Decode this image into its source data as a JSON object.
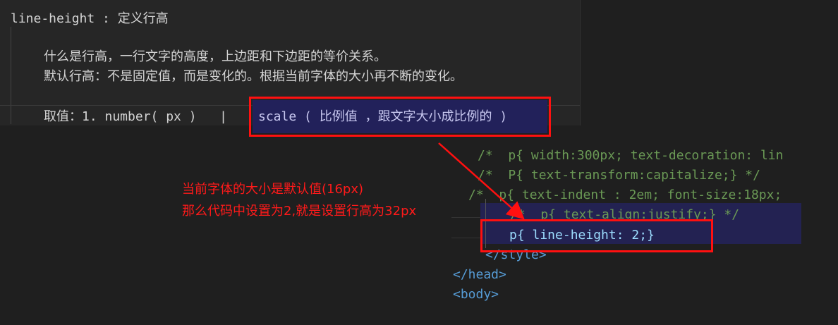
{
  "notes": {
    "title": "line-height : 定义行高",
    "line1": "什么是行高，一行文字的高度，上边距和下边距的等价关系。",
    "line2": "默认行高：不是固定值，而是变化的。根据当前字体的大小再不断的变化。",
    "values_prefix": "取值：1. number( px )   |",
    "values_highlight": "scale ( 比例值 ，跟文字大小成比例的 )"
  },
  "code": {
    "lines": [
      "/*  p{ width:300px; text-decoration: lin",
      "/*  P{ text-transform:capitalize;} */",
      "/*  p{ text-indent : 2em; font-size:18px;",
      "/*  p{ text-align:justify;} */",
      "p{ line-height: 2;}",
      "</style>",
      "</head>",
      "<body>"
    ]
  },
  "annotation": {
    "line1": "当前字体的大小是默认值(16px)",
    "line2": "那么代码中设置为2,就是设置行高为32px",
    "color": "#ff1a1a"
  }
}
